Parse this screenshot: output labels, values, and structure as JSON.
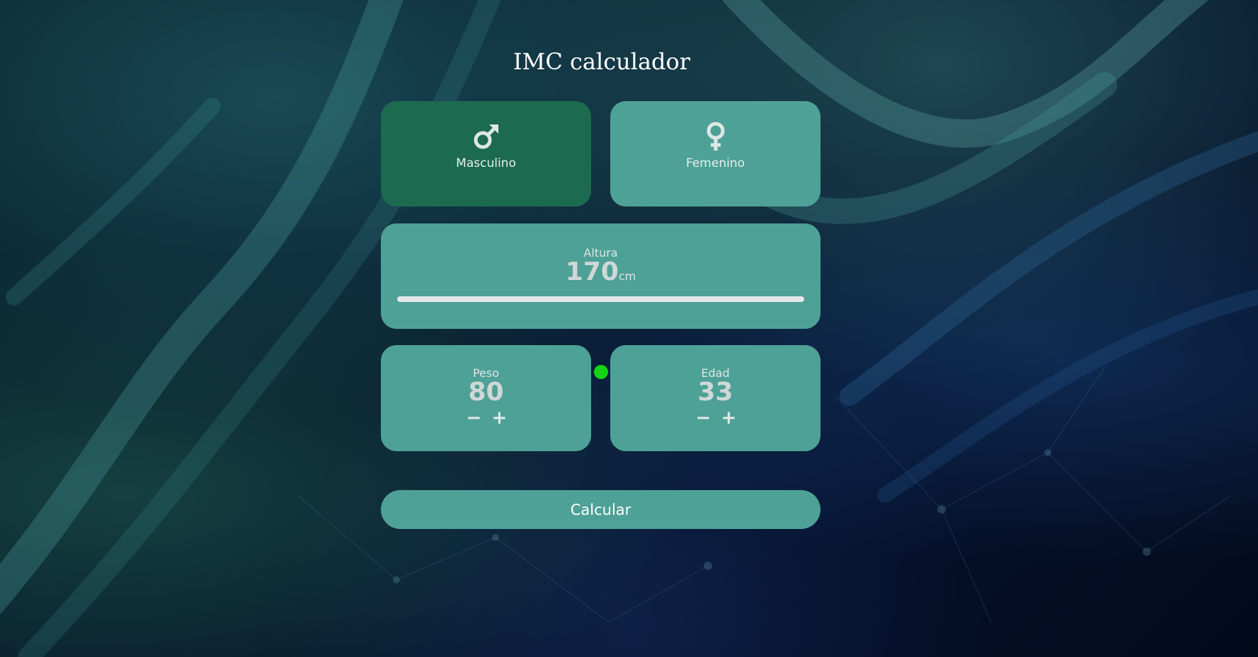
{
  "app": {
    "title": "IMC calculador"
  },
  "gender": {
    "male": {
      "label": "Masculino",
      "icon": "male-symbol-icon",
      "selected": true
    },
    "female": {
      "label": "Femenino",
      "icon": "female-symbol-icon",
      "selected": false
    }
  },
  "height": {
    "label": "Altura",
    "value": "170",
    "unit": "cm",
    "slider_fraction": 0.5
  },
  "weight": {
    "label": "Peso",
    "value": "80",
    "decrement": "−",
    "increment": "+"
  },
  "age": {
    "label": "Edad",
    "value": "33",
    "decrement": "−",
    "increment": "+"
  },
  "actions": {
    "calculate_label": "Calcular"
  },
  "colors": {
    "card": "#4ea196",
    "card_selected": "#1c6a50",
    "slider_thumb": "#14d414",
    "slider_track": "#e4e9e8",
    "title_text": "#ffffff"
  }
}
